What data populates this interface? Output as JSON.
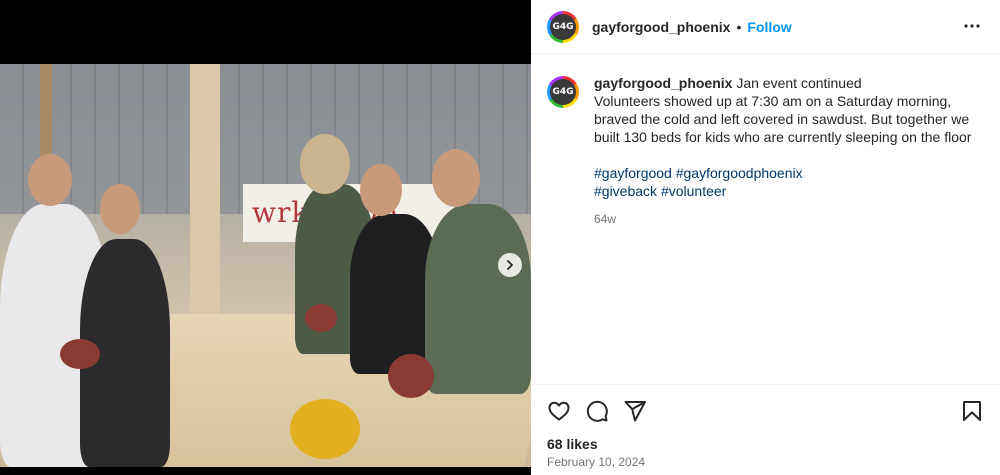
{
  "post": {
    "username": "gayforgood_phoenix",
    "avatar_text": "G4G",
    "follow_label": "Follow",
    "separator": "•",
    "caption_first_line": "Jan event continued",
    "caption_body": "Volunteers showed up at 7:30 am on a Saturday morning, braved the cold and left covered in sawdust. But together we built 130 beds for kids who are currently sleeping on the floor",
    "hashtags": [
      "#gayforgood",
      "#gayforgoodphoenix",
      "#giveback",
      "#volunteer"
    ],
    "age": "64w",
    "likes": "68 likes",
    "date": "February 10, 2024"
  },
  "photo": {
    "banner_text": "wrkSHOp"
  },
  "icons": {
    "more": "more-options-icon",
    "like": "heart-icon",
    "comment": "comment-icon",
    "share": "share-icon",
    "save": "bookmark-icon",
    "next": "chevron-right-icon"
  },
  "colors": {
    "link": "#0095f6",
    "hashtag": "#00376b",
    "muted": "#737373"
  }
}
